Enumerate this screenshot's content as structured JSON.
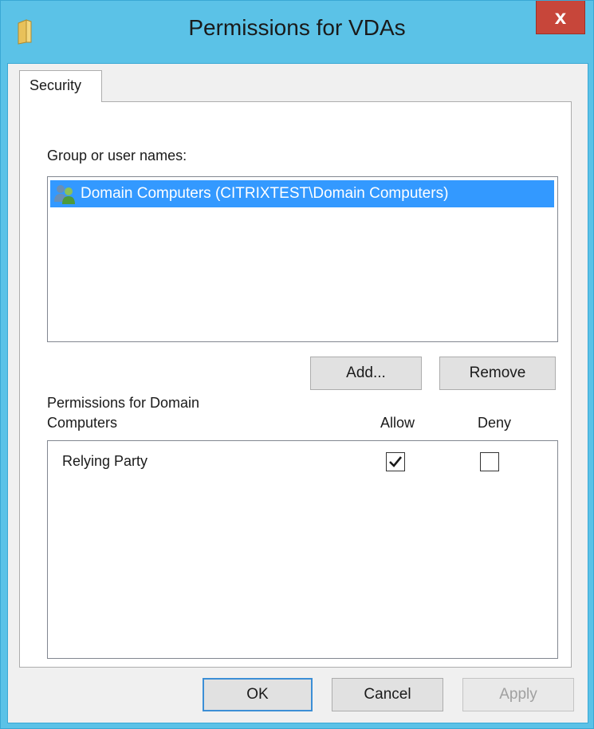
{
  "window": {
    "title": "Permissions for VDAs",
    "close_symbol": "x"
  },
  "tabs": [
    {
      "label": "Security"
    }
  ],
  "security": {
    "group_label": "Group or user names:",
    "principals": [
      {
        "name": "Domain Computers (CITRIXTEST\\Domain Computers)",
        "icon": "group-users-icon",
        "selected": true
      }
    ],
    "add_label": "Add...",
    "remove_label": "Remove",
    "permissions_label_line1": "Permissions for Domain",
    "permissions_label_line2": "Computers",
    "allow_header": "Allow",
    "deny_header": "Deny",
    "permissions": [
      {
        "name": "Relying Party",
        "allow": true,
        "deny": false
      }
    ]
  },
  "footer": {
    "ok_label": "OK",
    "cancel_label": "Cancel",
    "apply_label": "Apply"
  },
  "colors": {
    "titlebar": "#5bc2e7",
    "close": "#c7463a",
    "selection": "#3399ff"
  }
}
